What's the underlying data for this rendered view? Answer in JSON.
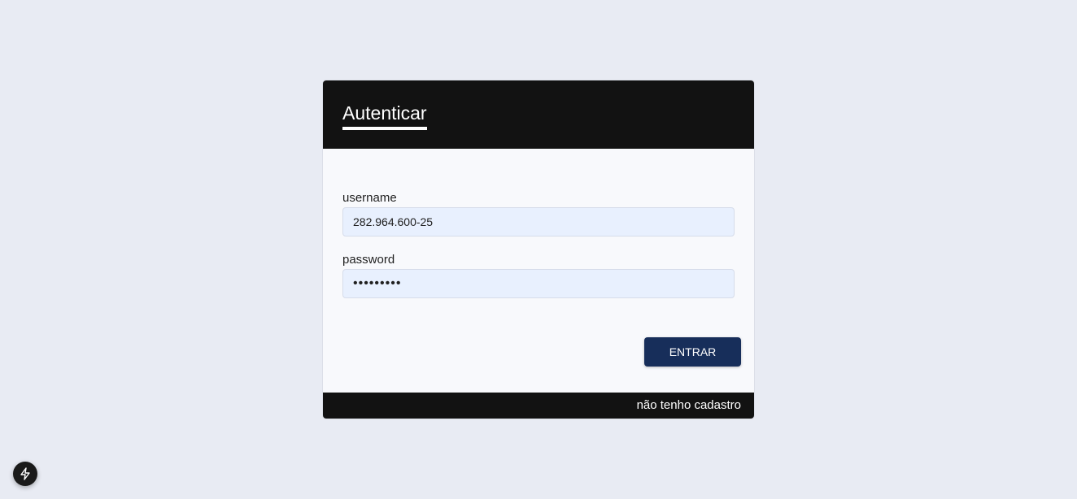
{
  "login": {
    "title": "Autenticar",
    "username_label": "username",
    "username_value": "282.964.600-25",
    "password_label": "password",
    "password_value": "123456789",
    "submit_label": "ENTRAR",
    "register_link": "não tenho cadastro"
  },
  "dev_badge": {
    "icon": "lightning-bolt-icon"
  },
  "colors": {
    "background": "#e8ebf3",
    "header": "#121212",
    "input_bg": "#e8f0fe",
    "button": "#172e5a"
  }
}
